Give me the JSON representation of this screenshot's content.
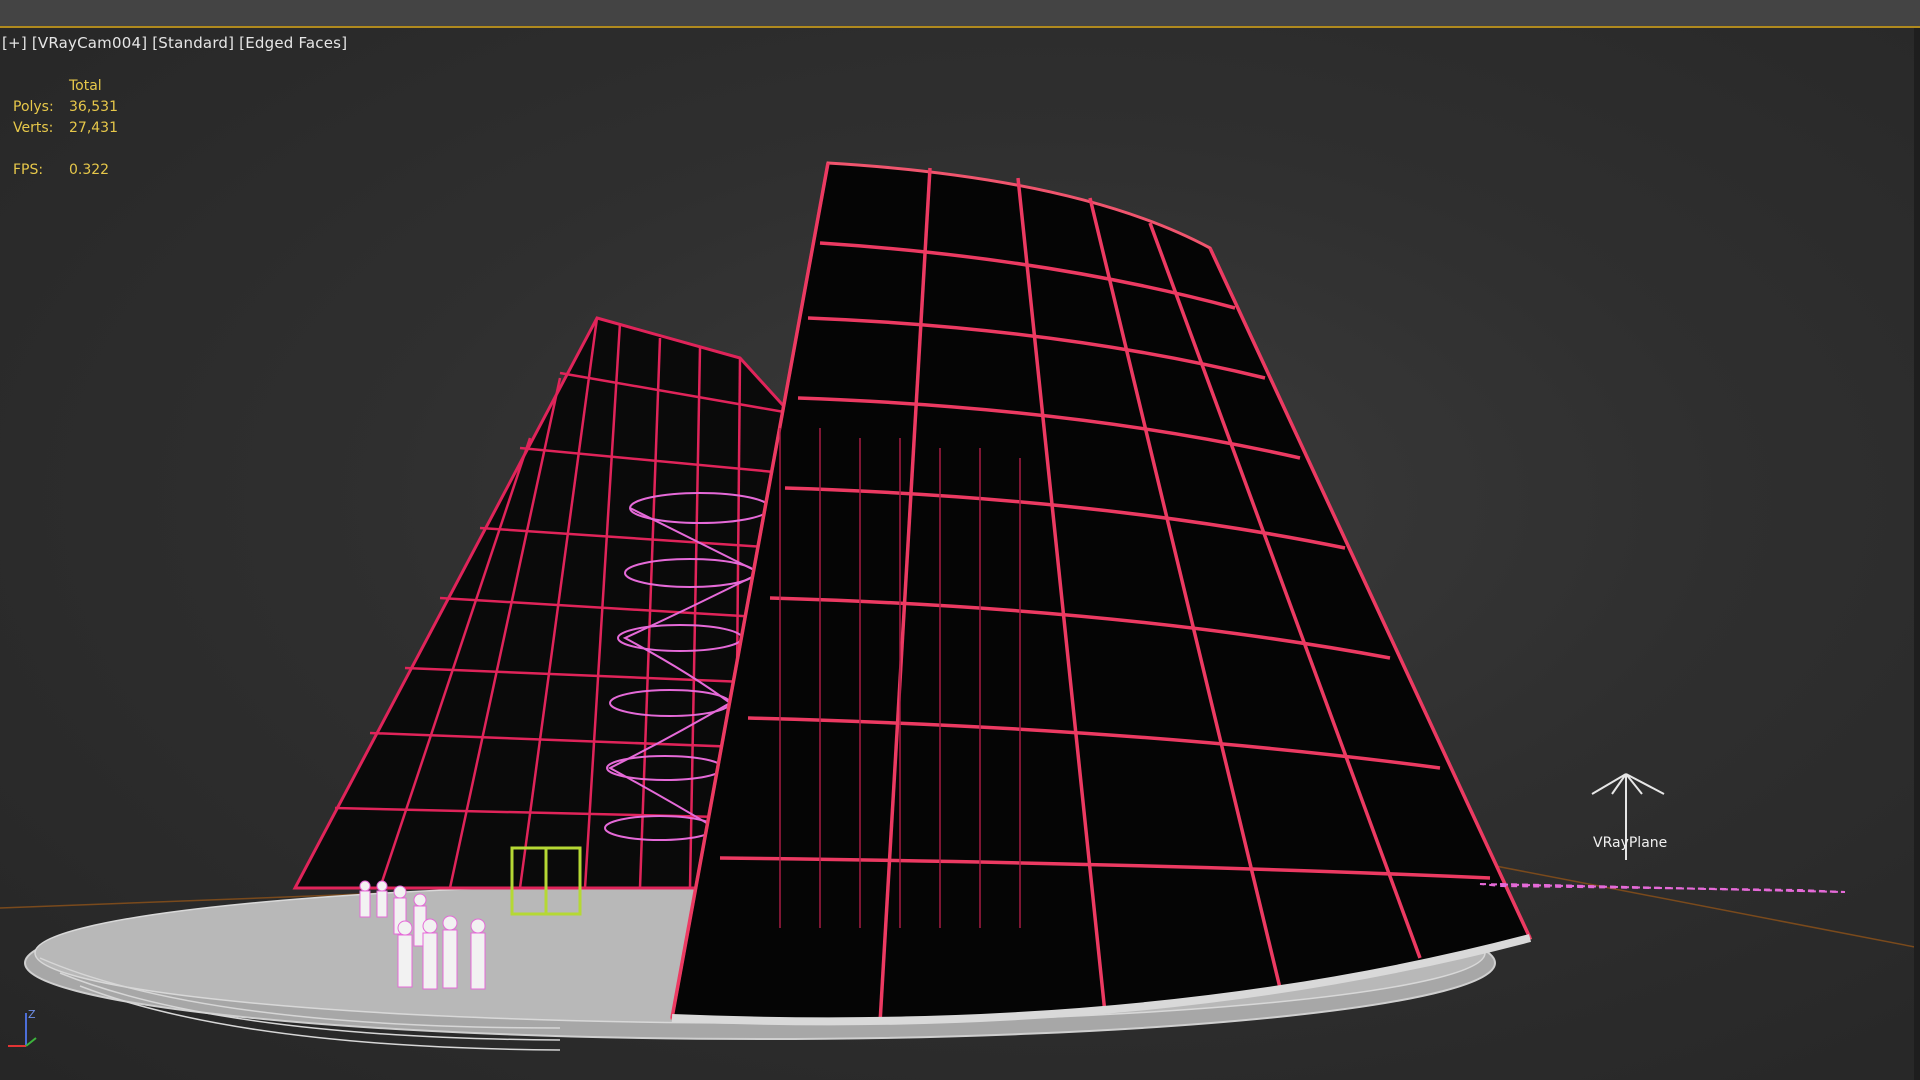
{
  "viewport": {
    "plus_menu": "[+]",
    "camera_menu": "[VRayCam004]",
    "shading_menu": "[Standard]",
    "display_menu": "[Edged Faces]"
  },
  "stats": {
    "header": "Total",
    "polys_label": "Polys:",
    "polys_value": "36,531",
    "verts_label": "Verts:",
    "verts_value": "27,431",
    "fps_label": "FPS:",
    "fps_value": "0.322"
  },
  "scene": {
    "light_label": "VRayPlane",
    "axis_label": "Z"
  },
  "colors": {
    "background": "#2f2f2f",
    "wireframe": "#e0245a",
    "stair": "#e56ad8",
    "glass": "#000000",
    "ground": "#bdbdbd",
    "door": "#b5d834",
    "stats_text": "#e7c84a"
  }
}
